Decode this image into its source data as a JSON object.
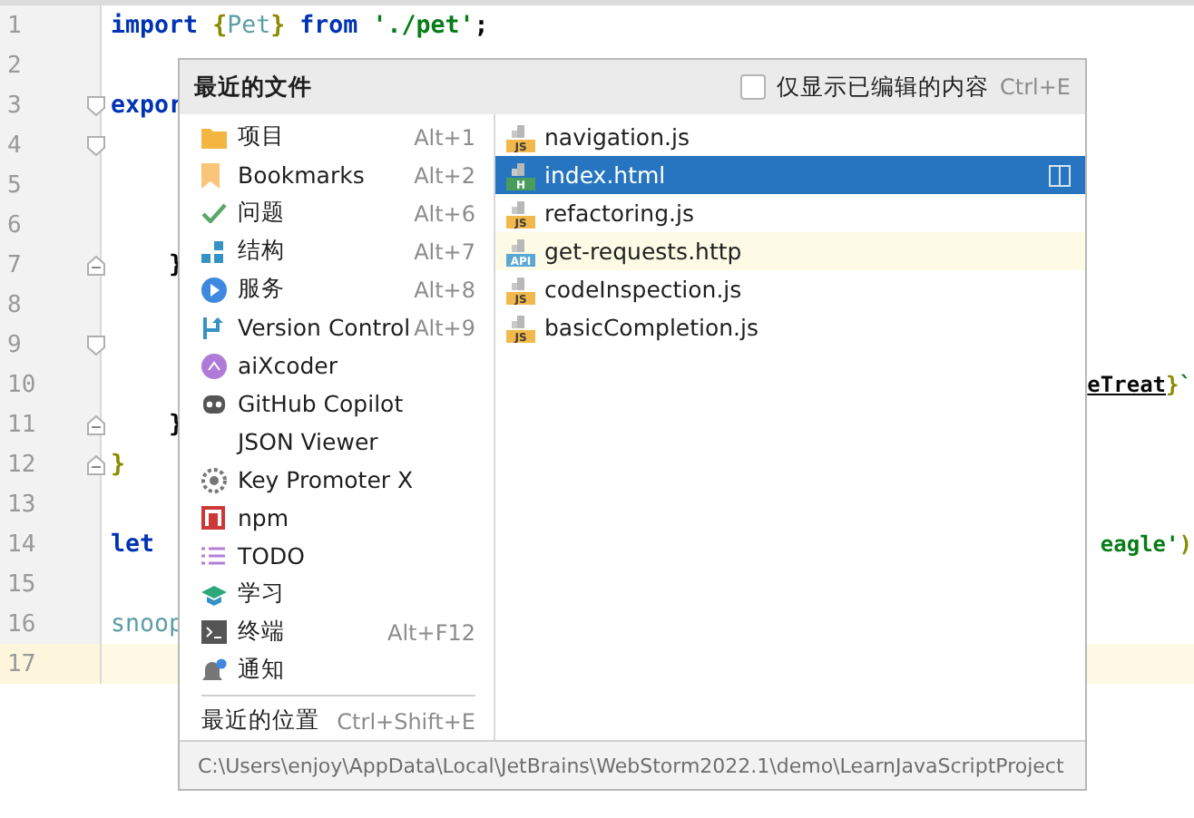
{
  "editor": {
    "lines": [
      {
        "number": "1",
        "current": false,
        "words": [
          [
            {
              "kind": "keyword",
              "text": "import"
            }
          ],
          [
            {
              "kind": "brace",
              "text": "{"
            },
            {
              "kind": "ident",
              "text": "Pet"
            },
            {
              "kind": "brace",
              "text": "}"
            }
          ],
          [
            {
              "kind": "keyword",
              "text": "from"
            }
          ],
          [
            {
              "kind": "string",
              "text": "'./pet'"
            },
            {
              "kind": "plain",
              "text": ";"
            }
          ]
        ]
      },
      {
        "number": "2",
        "current": false
      },
      {
        "number": "3",
        "current": false,
        "expanded": true,
        "words": [
          [
            {
              "kind": "keyword",
              "text": "expor"
            }
          ]
        ],
        "children": [
          {
            "number": "4",
            "current": false,
            "expanded": true,
            "children": [
              {
                "number": "5",
                "current": false
              },
              {
                "number": "6",
                "current": false
              }
            ],
            "end": {
              "number": "7",
              "current": false,
              "words": [
                [
                  {
                    "kind": "plain",
                    "text": "}"
                  }
                ]
              ]
            }
          },
          {
            "number": "8",
            "current": false
          },
          {
            "number": "9",
            "current": false,
            "expanded": true,
            "children": [
              {
                "number": "10",
                "current": false,
                "tail": [
                  {
                    "kind": "link",
                    "text": "eTreat"
                  },
                  {
                    "kind": "brace",
                    "text": "}"
                  },
                  {
                    "kind": "string",
                    "text": "`"
                  }
                ]
              }
            ],
            "end": {
              "number": "11",
              "current": false,
              "words": [
                [
                  {
                    "kind": "plain",
                    "text": "}"
                  }
                ]
              ]
            }
          }
        ],
        "end": {
          "number": "12",
          "current": false,
          "words": [
            [
              {
                "kind": "brace",
                "text": "}"
              }
            ]
          ]
        }
      },
      {
        "number": "13",
        "current": false
      },
      {
        "number": "14",
        "current": false,
        "words": [
          [
            {
              "kind": "keyword",
              "text": "let"
            }
          ]
        ],
        "tail": [
          {
            "kind": "string",
            "text": "eagle'"
          },
          {
            "kind": "brace",
            "text": ")"
          }
        ]
      },
      {
        "number": "15",
        "current": false
      },
      {
        "number": "16",
        "current": false,
        "words": [
          [
            {
              "kind": "ident",
              "text": "snoop"
            }
          ]
        ]
      },
      {
        "number": "17",
        "current": true
      }
    ]
  },
  "popup": {
    "title": "最近的文件",
    "filter": {
      "label": "仅显示已编辑的内容",
      "shortcut": "Ctrl+E",
      "checked": false
    },
    "tool_windows": [
      {
        "kind": "folder",
        "label": "项目",
        "shortcut": "Alt+1"
      },
      {
        "kind": "bookmark",
        "label": "Bookmarks",
        "shortcut": "Alt+2"
      },
      {
        "kind": "check",
        "label": "问题",
        "shortcut": "Alt+6"
      },
      {
        "kind": "structure",
        "label": "结构",
        "shortcut": "Alt+7"
      },
      {
        "kind": "services",
        "label": "服务",
        "shortcut": "Alt+8"
      },
      {
        "kind": "vcs",
        "label": "Version Control",
        "shortcut": "Alt+9"
      },
      {
        "kind": "ai",
        "label": "aiXcoder"
      },
      {
        "kind": "robot",
        "label": "GitHub Copilot"
      },
      {
        "kind": "plain",
        "label": "JSON Viewer"
      },
      {
        "kind": "gear",
        "label": "Key Promoter X"
      },
      {
        "kind": "npm",
        "label": "npm"
      },
      {
        "kind": "todo",
        "label": "TODO"
      },
      {
        "kind": "learn",
        "label": "学习"
      },
      {
        "kind": "terminal",
        "label": "终端",
        "shortcut": "Alt+F12"
      },
      {
        "kind": "bell",
        "label": "通知"
      }
    ],
    "recent_locations": {
      "label": "最近的位置",
      "shortcut": "Ctrl+Shift+E"
    },
    "files": [
      {
        "kind": "js",
        "badge": "JS",
        "name": "navigation.js",
        "selected": false,
        "current": false
      },
      {
        "kind": "html",
        "badge": "H",
        "name": "index.html",
        "selected": true,
        "current": false
      },
      {
        "kind": "js",
        "badge": "JS",
        "name": "refactoring.js",
        "selected": false,
        "current": false
      },
      {
        "kind": "api",
        "badge": "API",
        "name": "get-requests.http",
        "selected": false,
        "current": true
      },
      {
        "kind": "js",
        "badge": "JS",
        "name": "codeInspection.js",
        "selected": false,
        "current": false
      },
      {
        "kind": "js",
        "badge": "JS",
        "name": "basicCompletion.js",
        "selected": false,
        "current": false
      }
    ],
    "path": "C:\\Users\\enjoy\\AppData\\Local\\JetBrains\\WebStorm2022.1\\demo\\LearnJavaScriptProject"
  }
}
